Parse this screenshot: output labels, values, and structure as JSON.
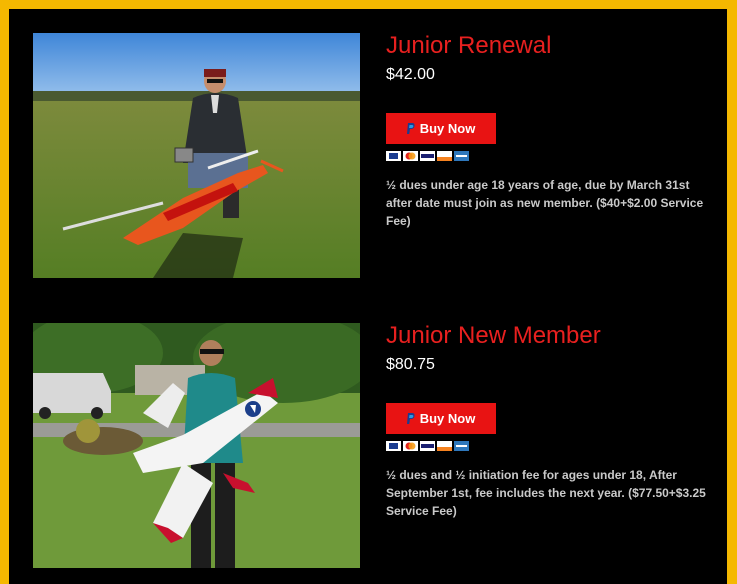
{
  "products": [
    {
      "title": "Junior Renewal",
      "price": "$42.00",
      "button_label": "Buy Now",
      "description": "½ dues under age 18 years of age, due by March 31st after date must join as new member. ($40+$2.00 Service Fee)",
      "image_alt": "Man kneeling on a grass field holding an orange RC helicopter and transmitter"
    },
    {
      "title": "Junior New Member",
      "price": "$80.75",
      "button_label": "Buy Now",
      "description": "½ dues and ½ initiation fee for ages under 18, After September 1st, fee includes the next year. ($77.50+$3.25 Service Fee)",
      "image_alt": "Man holding a white and red Navy RC airplane in front of trees"
    }
  ],
  "payment_icons": [
    "paypal-card-icon",
    "mastercard-icon",
    "visa-icon",
    "discover-icon",
    "amex-icon"
  ],
  "colors": {
    "frame": "#f5b800",
    "title": "#e8201f",
    "button": "#e81313"
  }
}
